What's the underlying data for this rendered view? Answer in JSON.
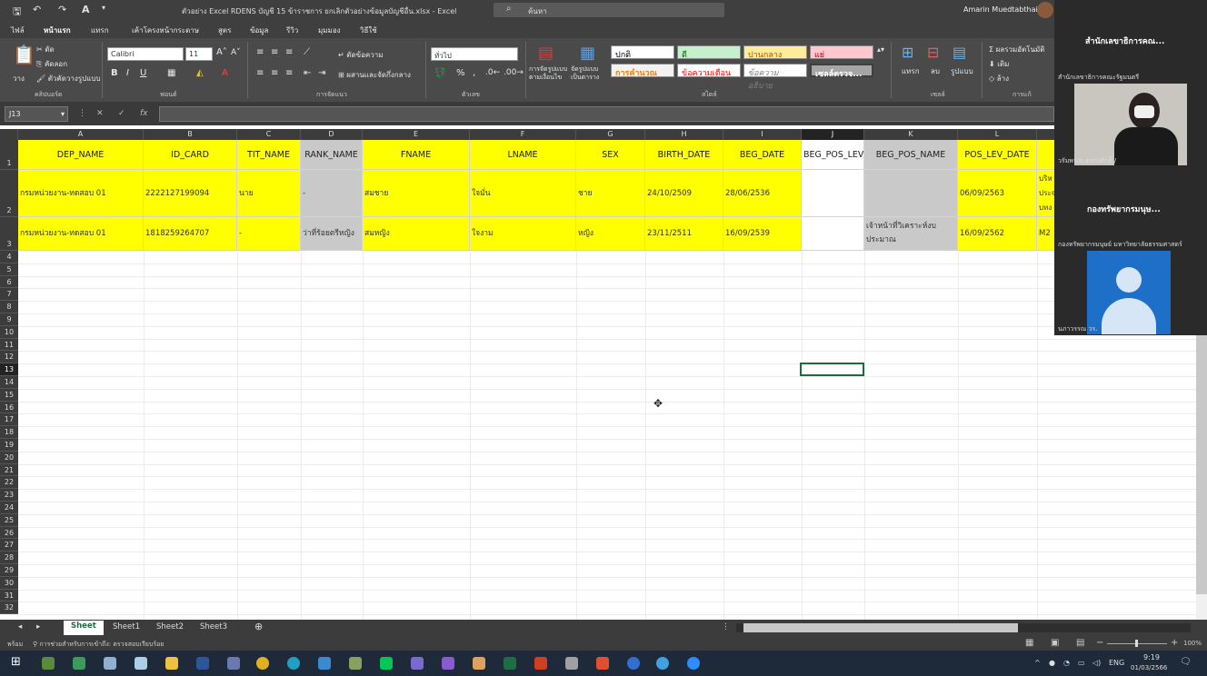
{
  "titlebar": {
    "title": "ตัวอย่าง Excel RDENS บัญชี 15 ข้าราชการ ยกเลิกตัวอย่างข้อมูลบัญชีอื่น.xlsx - Excel",
    "search": "ค้นหา",
    "user": "Amarin Muedtabthai"
  },
  "tabs": [
    "ไฟล์",
    "หน้าแรก",
    "แทรก",
    "เค้าโครงหน้ากระดาษ",
    "สูตร",
    "ข้อมูล",
    "รีวิว",
    "มุมมอง",
    "วิธีใช้"
  ],
  "ribbon": {
    "paste": "วาง",
    "cut": "ตัด",
    "copy": "คัดลอก",
    "format_painter": "ตัวคัดวางรูปแบบ",
    "clipboard": "คลิปบอร์ด",
    "font_name": "Calibri",
    "font_size": "11",
    "font": "ฟอนต์",
    "wrap": "ตัดข้อความ",
    "merge": "ผสานและจัดกึ่งกลาง",
    "alignment": "การจัดแนว",
    "number_format": "ทั่วไป",
    "number": "ตัวเลข",
    "cond_format": "การจัดรูปแบบตามเงื่อนไข",
    "format_table": "จัดรูปแบบเป็นตาราง",
    "styles": {
      "normal": "ปกติ",
      "good": "ดี",
      "neutral": "ปานกลาง",
      "bad": "แย่",
      "calc": "การคำนวณ",
      "warning": "ข้อความเตือน",
      "explanatory": "ข้อความอธิบาย",
      "check": "เซลล์ตรวจ..."
    },
    "styles_label": "สไตล์",
    "insert": "แทรก",
    "delete": "ลบ",
    "format": "รูปแบบ",
    "cells": "เซลล์",
    "autosum": "ผลรวมอัตโนมัติ",
    "fill": "เติม",
    "clear": "ล้าง",
    "editing": "การแก้"
  },
  "formula_bar": {
    "name_box": "J13",
    "fx": "fx"
  },
  "columns": [
    {
      "letter": "A",
      "header": "DEP_NAME"
    },
    {
      "letter": "B",
      "header": "ID_CARD"
    },
    {
      "letter": "C",
      "header": "TIT_NAME"
    },
    {
      "letter": "D",
      "header": "RANK_NAME"
    },
    {
      "letter": "E",
      "header": "FNAME"
    },
    {
      "letter": "F",
      "header": "LNAME"
    },
    {
      "letter": "G",
      "header": "SEX"
    },
    {
      "letter": "H",
      "header": "BIRTH_DATE"
    },
    {
      "letter": "I",
      "header": "BEG_DATE"
    },
    {
      "letter": "J",
      "header": "BEG_POS_LEV"
    },
    {
      "letter": "K",
      "header": "BEG_POS_NAME"
    },
    {
      "letter": "L",
      "header": "POS_LEV_DATE"
    }
  ],
  "rows": [
    [
      "กรมหน่วยงาน-ทดสอบ 01",
      "2222127199094",
      "นาย",
      "-",
      "สมชาย",
      "ใจมั่น",
      "ชาย",
      "24/10/2509",
      "28/06/2536",
      "",
      "",
      "06/09/2563"
    ],
    [
      "กรมหน่วยงาน-ทดสอบ 01",
      "1818259264707",
      "-",
      "ว่าที่ร้อยตรีหญิง",
      "สมหญิง",
      "ใจงาม",
      "หญิง",
      "23/11/2511",
      "16/09/2539",
      "",
      "เจ้าหน้าที่วิเคราะห์งบประมาณ",
      "16/09/2562"
    ]
  ],
  "overflow_col_m": {
    "r2a": "บริห",
    "r2b": "ประจ",
    "r2c": "บทง",
    "r3": "M2"
  },
  "row_numbers": [
    "1",
    "2",
    "3",
    "4",
    "5",
    "6",
    "7",
    "8",
    "9",
    "10",
    "11",
    "12",
    "13",
    "14",
    "15",
    "16",
    "17",
    "18",
    "19",
    "20",
    "21",
    "22",
    "23",
    "24",
    "25",
    "26",
    "27",
    "28",
    "29",
    "30",
    "31",
    "32"
  ],
  "sheets": [
    "Sheet",
    "Sheet1",
    "Sheet2",
    "Sheet3"
  ],
  "status": {
    "ready": "พร้อม",
    "accessibility": "การช่วยสำหรับการเข้าถึง: ตรวจสอบเรียบร้อย",
    "zoom": "100%"
  },
  "taskbar": {
    "time": "9:19",
    "date": "01/03/2566",
    "lang": "ENG"
  },
  "teams": {
    "p1_name": "สำนักเลขาธิการคณ...",
    "p1_sub": "สำนักเลขาธิการคณะรัฐมนตรี",
    "p2_caption": "วรัมพร/ม.ธรรมศักดิ์ /",
    "p3_name": "กองทรัพยากรมนุษ...",
    "p3_sub": "กองทรัพยากรมนุษย์ มหาวิทยาลัยธรรมศาสตร์",
    "p4_caption": "นภาวรรณ วร."
  }
}
